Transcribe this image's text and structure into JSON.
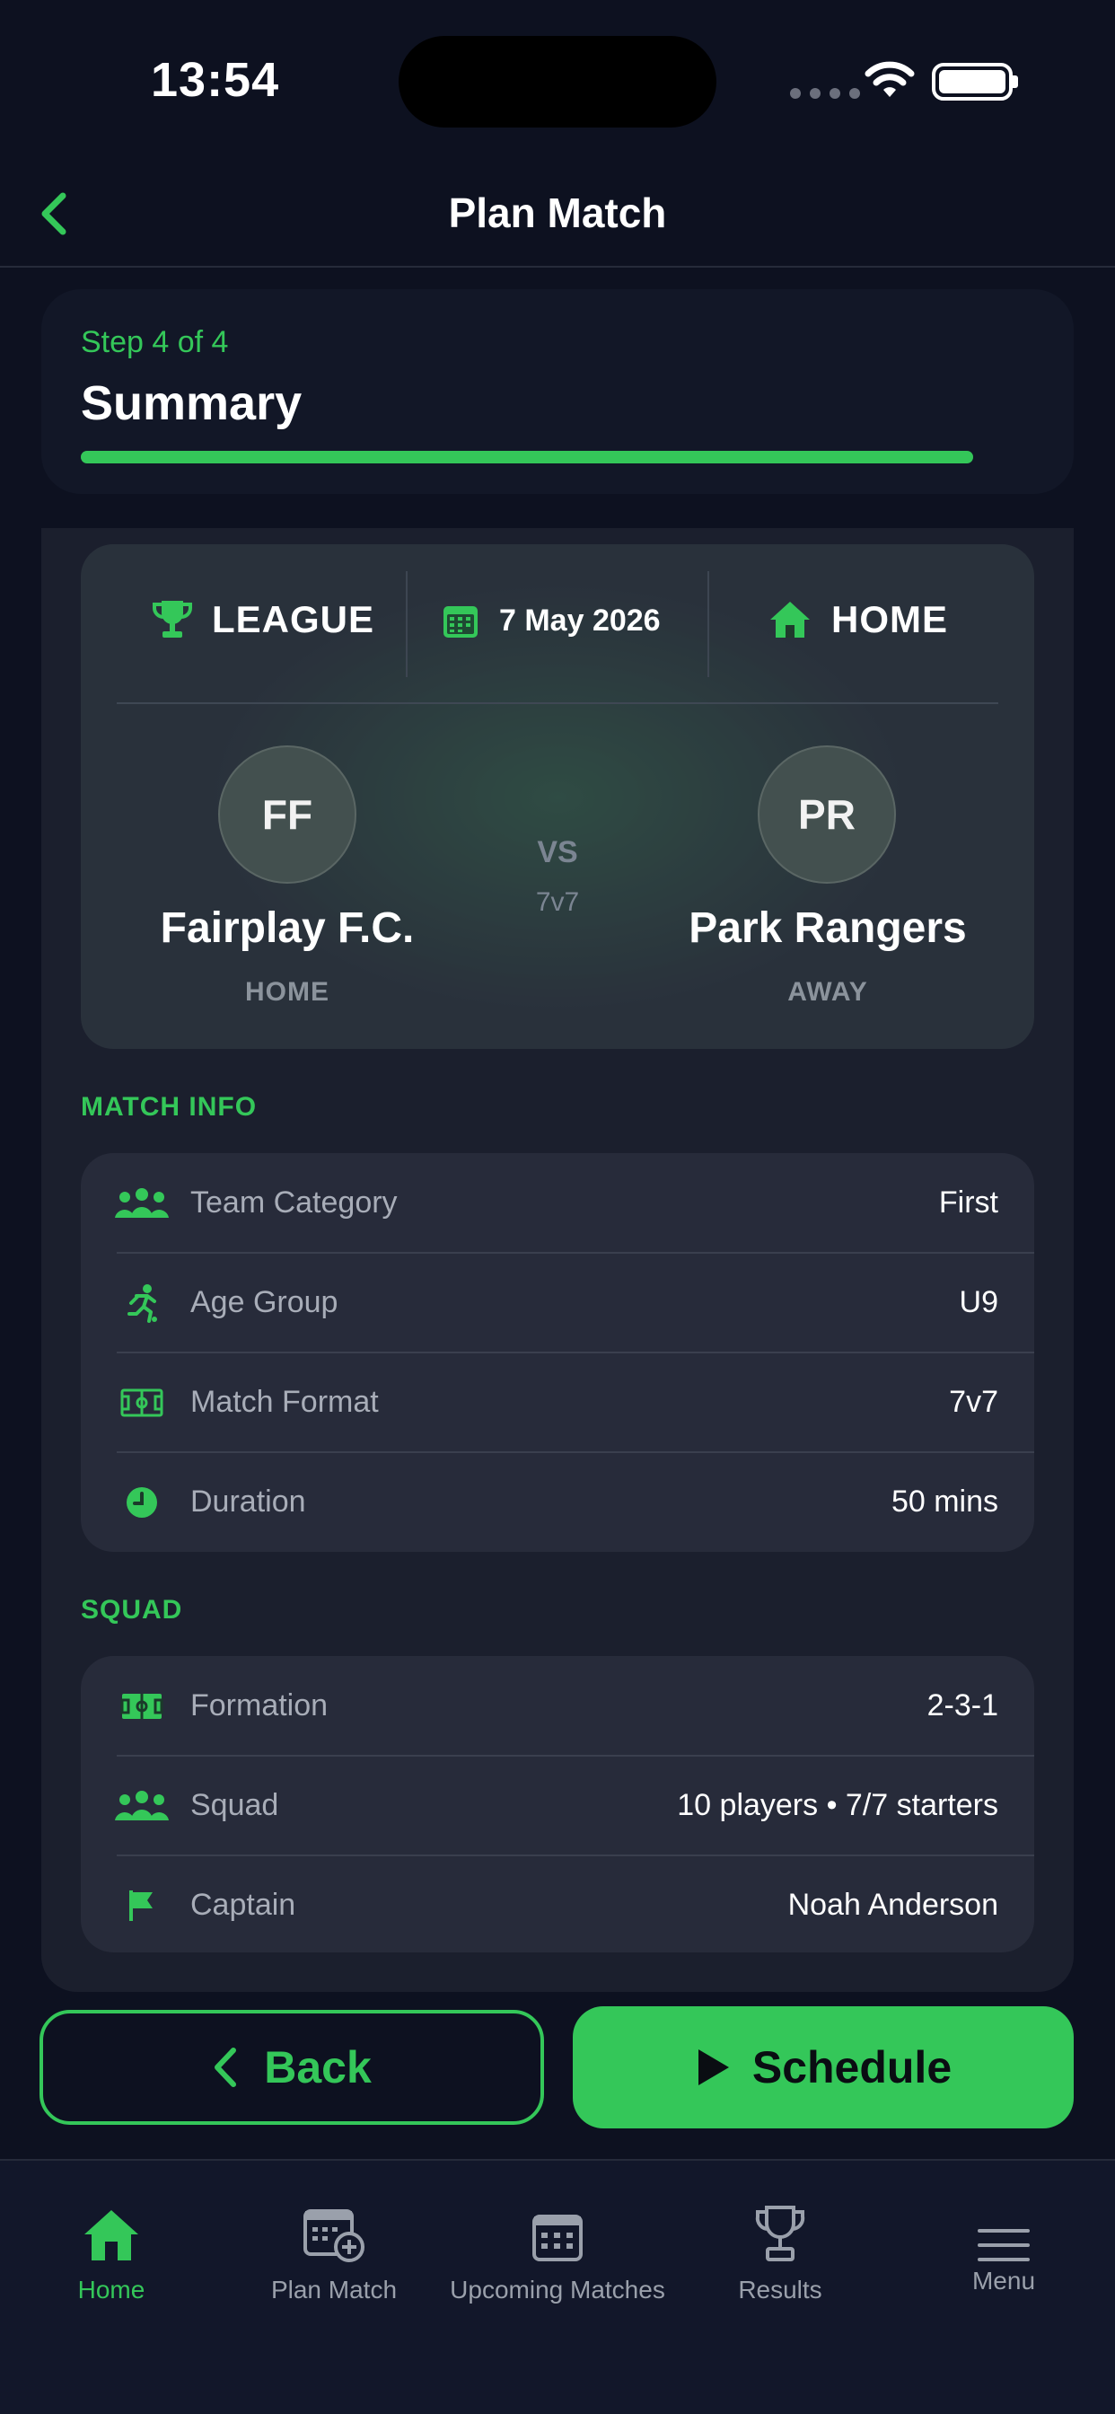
{
  "status_bar": {
    "time": "13:54"
  },
  "nav": {
    "title": "Plan Match"
  },
  "step": {
    "label": "Step 4 of 4",
    "title": "Summary",
    "progress": 1.0
  },
  "match": {
    "competition": "LEAGUE",
    "date": "7 May 2026",
    "venue": "HOME",
    "home": {
      "initials": "FF",
      "name": "Fairplay F.C.",
      "side": "HOME"
    },
    "away": {
      "initials": "PR",
      "name": "Park Rangers",
      "side": "AWAY"
    },
    "vs": "VS",
    "format": "7v7"
  },
  "match_info": {
    "title": "MATCH INFO",
    "rows": [
      {
        "label": "Team Category",
        "value": "First",
        "icon": "team-icon"
      },
      {
        "label": "Age Group",
        "value": "U9",
        "icon": "runner-icon"
      },
      {
        "label": "Match Format",
        "value": "7v7",
        "icon": "pitch-icon"
      },
      {
        "label": "Duration",
        "value": "50 mins",
        "icon": "clock-icon"
      }
    ]
  },
  "squad": {
    "title": "SQUAD",
    "rows": [
      {
        "label": "Formation",
        "value": "2-3-1",
        "icon": "formation-icon"
      },
      {
        "label": "Squad",
        "value": "10 players • 7/7 starters",
        "icon": "team-icon"
      },
      {
        "label": "Captain",
        "value": "Noah Anderson",
        "icon": "flag-icon"
      }
    ]
  },
  "buttons": {
    "back": "Back",
    "schedule": "Schedule"
  },
  "tabs": [
    {
      "label": "Home",
      "icon": "home-icon",
      "active": true
    },
    {
      "label": "Plan Match",
      "icon": "calendar-plus-icon",
      "active": false
    },
    {
      "label": "Upcoming Matches",
      "icon": "calendar-icon",
      "active": false
    },
    {
      "label": "Results",
      "icon": "trophy-icon",
      "active": false
    },
    {
      "label": "Menu",
      "icon": "menu-icon",
      "active": false
    }
  ],
  "colors": {
    "accent": "#34c759",
    "background": "#0d1120",
    "card": "#272b3a"
  }
}
